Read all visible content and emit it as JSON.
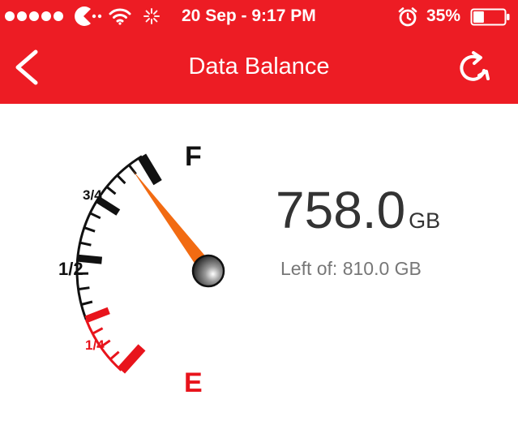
{
  "status_bar": {
    "time": "20 Sep - 9:17 PM",
    "battery_percent": "35%",
    "battery_level": 0.35,
    "icons": [
      "signal-dots-icon",
      "carrier-logo-icon",
      "wifi-icon",
      "activity-spinner-icon",
      "alarm-icon",
      "battery-icon"
    ]
  },
  "header": {
    "title": "Data Balance",
    "back_icon": "chevron-left-icon",
    "refresh_icon": "refresh-icon",
    "background": "#ED1C24"
  },
  "gauge": {
    "labels": {
      "full": "F",
      "three_quarter": "3/4",
      "half": "1/2",
      "quarter": "1/4",
      "empty": "E"
    },
    "fraction_remaining": 0.936,
    "colors": {
      "normal": "#111111",
      "low": "#E8141C",
      "needle": "#F26B12"
    }
  },
  "balance": {
    "value": "758.0",
    "unit": "GB",
    "total_label": "Left of: 810.0 GB"
  }
}
